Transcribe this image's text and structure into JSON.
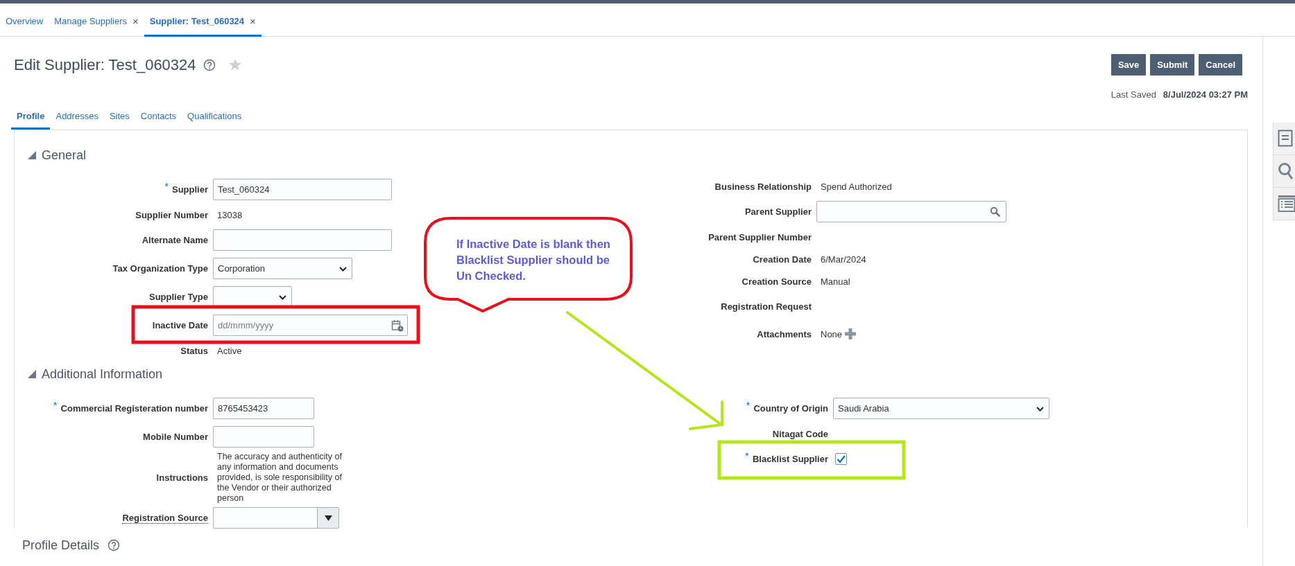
{
  "top_tabs": [
    {
      "label": "Overview",
      "selected": false
    },
    {
      "label": "Manage Suppliers",
      "close": "×",
      "selected": false
    },
    {
      "label": "Supplier: Test_060324",
      "close": "×",
      "selected": true
    }
  ],
  "page": {
    "title": "Edit Supplier: Test_060324",
    "favorite": false,
    "buttons": [
      "Save",
      "Submit",
      "Cancel"
    ],
    "last_saved_label": "Last Saved",
    "last_saved_value": "8/Jul/2024 03:27 PM"
  },
  "subtabs": [
    {
      "label": "Profile",
      "selected": true
    },
    {
      "label": "Addresses",
      "selected": false
    },
    {
      "label": "Sites",
      "selected": false
    },
    {
      "label": "Contacts",
      "selected": false
    },
    {
      "label": "Qualifications",
      "selected": false
    }
  ],
  "sections": [
    {
      "title": "General",
      "expanded": true,
      "left": [
        {
          "kind": "text",
          "label": "Supplier",
          "required_mark": "*",
          "value": "Test_060324"
        },
        {
          "kind": "display",
          "label": "Supplier Number",
          "value": "13038"
        },
        {
          "kind": "text",
          "label": "Alternate Name"
        },
        {
          "kind": "select",
          "label": "Tax Organization Type",
          "value": "Corporation"
        },
        {
          "kind": "select",
          "label": "Supplier Type"
        },
        {
          "kind": "date",
          "label": "Inactive Date",
          "placeholder": "dd/mmm/yyyy"
        },
        {
          "kind": "display",
          "label": "Status",
          "value": "Active"
        }
      ],
      "right": [
        {
          "kind": "display",
          "label": "Business Relationship",
          "value": "Spend Authorized"
        },
        {
          "kind": "lov",
          "label": "Parent Supplier"
        },
        {
          "kind": "display",
          "label": "Parent Supplier Number"
        },
        {
          "kind": "display",
          "label": "Creation Date",
          "value": "6/Mar/2024"
        },
        {
          "kind": "display",
          "label": "Creation Source",
          "value": "Manual"
        },
        {
          "kind": "label",
          "label": "Registration Request"
        },
        {
          "kind": "attachments",
          "label": "Attachments",
          "value": "None"
        }
      ]
    },
    {
      "title": "Additional Information",
      "expanded": true,
      "left": [
        {
          "kind": "text",
          "label": "Commercial Registeration number",
          "required_mark": "*",
          "value": "8765453423"
        },
        {
          "kind": "text",
          "label": "Mobile Number"
        },
        {
          "kind": "note",
          "label": "Instructions",
          "value": "The accuracy and authenticity of any information and documents provided, is sole responsibility of the Vendor or their authorized person"
        },
        {
          "kind": "choice",
          "label": "Registration Source",
          "help": true
        }
      ],
      "right": [
        {
          "kind": "select",
          "label": "Country of Origin",
          "required_mark": "*",
          "value": "Saudi Arabia"
        },
        {
          "kind": "display",
          "label": "Nitagat Code"
        },
        {
          "kind": "checkbox",
          "label": "Blacklist Supplier",
          "required_mark": "*",
          "checked": true
        }
      ]
    }
  ],
  "profile_details": {
    "title": "Profile Details"
  },
  "annotations": [
    {
      "kind": "callout",
      "color": "#e8101d",
      "text": "If Inactive Date is blank then\nBlacklist Supplier should be\nUn Checked."
    },
    {
      "kind": "frame",
      "color": "#e8101d"
    },
    {
      "kind": "arrow",
      "color": "#b5e61d"
    },
    {
      "kind": "frame",
      "color": "#b5e61d"
    }
  ]
}
